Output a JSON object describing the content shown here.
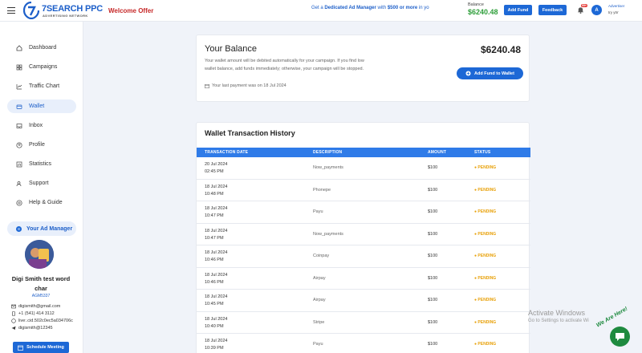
{
  "topbar": {
    "logo_text": "7SEARCH PPC",
    "logo_sub": "ADVERTISING NETWORK",
    "welcome": "Welcome Offer",
    "promo_pre": "Get a ",
    "promo_bold1": "Dedicated Ad Manager",
    "promo_mid": " with ",
    "promo_bold2": "$500 or more",
    "promo_post": " in yo",
    "balance_label": "Balance",
    "balance_value": "$6240.48",
    "add_fund_label": "Add Fund",
    "feedback_label": "Feedback",
    "notif_count": "99+",
    "avatar_letter": "A",
    "user_role": "Advertiser",
    "user_name": "try ytrr"
  },
  "sidebar": {
    "items": [
      {
        "label": "Dashboard",
        "icon": "home-icon"
      },
      {
        "label": "Campaigns",
        "icon": "campaign-icon"
      },
      {
        "label": "Traffic Chart",
        "icon": "chart-icon"
      },
      {
        "label": "Wallet",
        "icon": "wallet-icon",
        "active": true
      },
      {
        "label": "Inbox",
        "icon": "inbox-icon"
      },
      {
        "label": "Profile",
        "icon": "profile-icon"
      },
      {
        "label": "Statistics",
        "icon": "statistics-icon"
      },
      {
        "label": "Support",
        "icon": "support-icon"
      },
      {
        "label": "Help & Guide",
        "icon": "help-icon"
      }
    ],
    "manager_label": "Your Ad Manager",
    "manager_num": "8",
    "manager_name": "Digi Smith test word char",
    "manager_code": "AGM5337",
    "contacts": {
      "email": "digismith@gmail.com",
      "phone": "+1 (541) 414 3112",
      "skype": "live:.cid.502c0ec5a034706c",
      "telegram": "digismith@12345"
    },
    "schedule_label": "Schedule Meeting"
  },
  "balance_card": {
    "title": "Your Balance",
    "amount": "$6240.48",
    "description": "Your wallet amount will be debited automatically for your campaign. If you find low wallet balance, add funds immediately; otherwise, your campaign will be stopped.",
    "last_payment": "Your last payment was on 18 Jul 2024",
    "add_button": "Add Fund to Wallet"
  },
  "history": {
    "title": "Wallet Transaction History",
    "columns": [
      "TRANSACTION DATE",
      "DESCRIPTION",
      "AMOUNT",
      "STATUS"
    ],
    "rows": [
      {
        "date": "20 Jul 2024",
        "time": "02:45 PM",
        "desc": "Now_payments",
        "amount": "$100",
        "status": "● PENDING"
      },
      {
        "date": "18 Jul 2024",
        "time": "10:48 PM",
        "desc": "Phonepe",
        "amount": "$100",
        "status": "● PENDING"
      },
      {
        "date": "18 Jul 2024",
        "time": "10:47 PM",
        "desc": "Payu",
        "amount": "$100",
        "status": "● PENDING"
      },
      {
        "date": "18 Jul 2024",
        "time": "10:47 PM",
        "desc": "Now_payments",
        "amount": "$100",
        "status": "● PENDING"
      },
      {
        "date": "18 Jul 2024",
        "time": "10:46 PM",
        "desc": "Coinpay",
        "amount": "$100",
        "status": "● PENDING"
      },
      {
        "date": "18 Jul 2024",
        "time": "10:46 PM",
        "desc": "Airpay",
        "amount": "$100",
        "status": "● PENDING"
      },
      {
        "date": "18 Jul 2024",
        "time": "10:45 PM",
        "desc": "Airpay",
        "amount": "$100",
        "status": "● PENDING"
      },
      {
        "date": "18 Jul 2024",
        "time": "10:40 PM",
        "desc": "Stripe",
        "amount": "$100",
        "status": "● PENDING"
      },
      {
        "date": "18 Jul 2024",
        "time": "10:39 PM",
        "desc": "Payu",
        "amount": "$100",
        "status": "● PENDING"
      }
    ]
  },
  "overlay": {
    "activate_title": "Activate Windows",
    "activate_sub": "Go to Settings to activate Wi",
    "chat_badge": "We Are Here!"
  },
  "colors": {
    "accent": "#1d68d6",
    "table_header": "#2f7be8",
    "balance_green": "#2e9e3a",
    "pending": "#e8a10a",
    "welcome_red": "#c62828"
  }
}
